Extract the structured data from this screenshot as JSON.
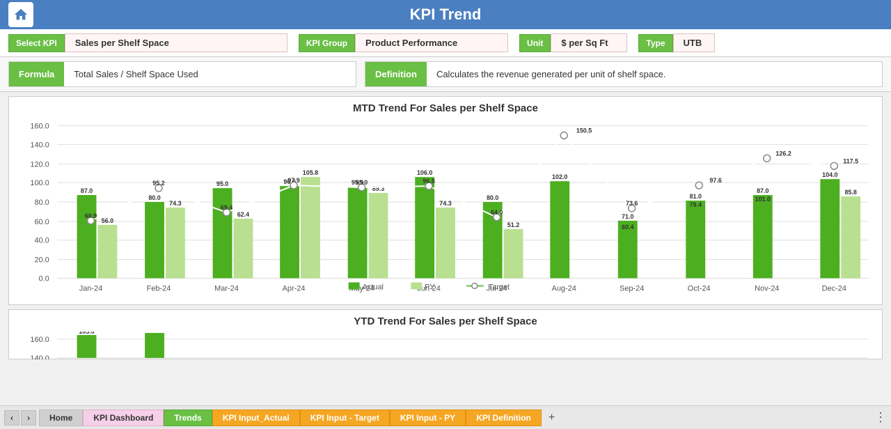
{
  "header": {
    "title": "KPI Trend",
    "home_icon": "home-icon"
  },
  "controls": {
    "select_kpi_label": "Select KPI",
    "select_kpi_value": "Sales per Shelf Space",
    "kpi_group_label": "KPI Group",
    "kpi_group_value": "Product Performance",
    "unit_label": "Unit",
    "unit_value": "$ per Sq Ft",
    "type_label": "Type",
    "type_value": "UTB"
  },
  "formula": {
    "label": "Formula",
    "content": "Total Sales / Shelf Space Used"
  },
  "definition": {
    "label": "Definition",
    "content": "Calculates the revenue generated per unit of shelf space."
  },
  "mtd_chart": {
    "title": "MTD Trend For Sales per Shelf Space",
    "legend": {
      "actual": "Actual",
      "py": "PY",
      "target": "Target"
    },
    "months": [
      "Jan-24",
      "Feb-24",
      "Mar-24",
      "Apr-24",
      "May-24",
      "Jun-24",
      "Jul-24",
      "Aug-24",
      "Sep-24",
      "Oct-24",
      "Nov-24",
      "Dec-24"
    ],
    "actual": [
      87.0,
      80.0,
      95.0,
      96.8,
      95.9,
      106.0,
      80.0,
      102.0,
      71.0,
      81.0,
      87.0,
      104.0
    ],
    "py": [
      56.0,
      74.3,
      62.4,
      105.8,
      89.3,
      74.3,
      51.2,
      null,
      null,
      null,
      null,
      85.8
    ],
    "target": [
      60.9,
      95.2,
      69.4,
      97.9,
      95.0,
      96.5,
      64.0,
      150.5,
      73.6,
      97.6,
      126.2,
      117.5
    ],
    "extra_labels": {
      "aug_target": 150.5,
      "sep_actual": 60.4,
      "oct_actual": 79.4,
      "nov_actual": 101.0,
      "dec_actual": 104.0
    }
  },
  "ytd_chart": {
    "title": "YTD Trend For Sales per Shelf Space"
  },
  "tabs": {
    "items": [
      {
        "label": "Home",
        "active": false,
        "style": "normal"
      },
      {
        "label": "KPI Dashboard",
        "active": false,
        "style": "light-pink"
      },
      {
        "label": "Trends",
        "active": true,
        "style": "green"
      },
      {
        "label": "KPI Input_Actual",
        "active": false,
        "style": "orange"
      },
      {
        "label": "KPI Input - Target",
        "active": false,
        "style": "orange"
      },
      {
        "label": "KPI Input - PY",
        "active": false,
        "style": "orange"
      },
      {
        "label": "KPI Definition",
        "active": false,
        "style": "orange"
      }
    ]
  }
}
